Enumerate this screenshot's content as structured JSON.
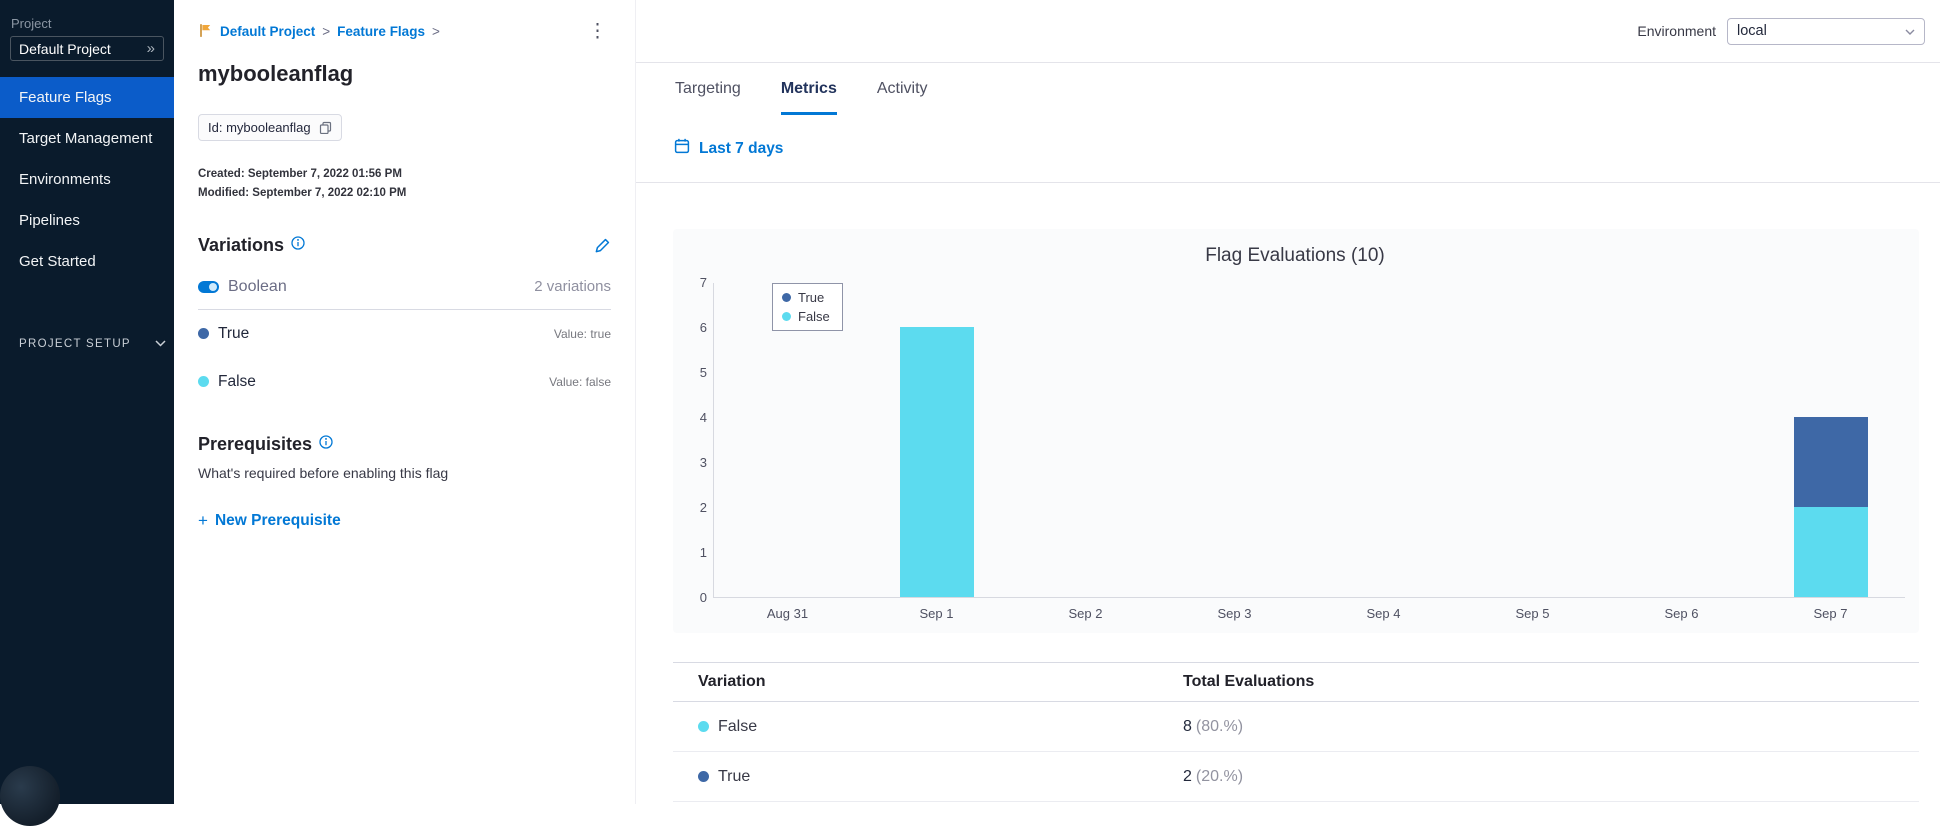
{
  "icons": {
    "kebab": "⋮",
    "expand": "»",
    "plus": "+",
    "crumb_separator": ">"
  },
  "sidebar": {
    "project_label": "Project",
    "project_selector": "Default Project",
    "items": [
      {
        "label": "Feature Flags",
        "active": true
      },
      {
        "label": "Target Management",
        "active": false
      },
      {
        "label": "Environments",
        "active": false
      },
      {
        "label": "Pipelines",
        "active": false
      },
      {
        "label": "Get Started",
        "active": false
      }
    ],
    "project_setup_label": "PROJECT SETUP"
  },
  "detail": {
    "breadcrumb": {
      "project": "Default Project",
      "section": "Feature Flags"
    },
    "title": "mybooleanflag",
    "id_badge": "Id: mybooleanflag",
    "created": "Created: September 7, 2022 01:56 PM",
    "modified": "Modified: September 7, 2022 02:10 PM",
    "variations": {
      "heading": "Variations",
      "type_label": "Boolean",
      "count_label": "2 variations",
      "items": [
        {
          "name": "True",
          "value_label": "Value: true",
          "color": "#3e68a6"
        },
        {
          "name": "False",
          "value_label": "Value: false",
          "color": "#5cdbef"
        }
      ]
    },
    "prerequisites": {
      "heading": "Prerequisites",
      "description": "What's required before enabling this flag",
      "new_button_label": "New Prerequisite"
    }
  },
  "main": {
    "environment_label": "Environment",
    "environment_value": "local",
    "tabs": [
      {
        "label": "Targeting",
        "active": false
      },
      {
        "label": "Metrics",
        "active": true
      },
      {
        "label": "Activity",
        "active": false
      }
    ],
    "date_range_label": "Last 7 days",
    "table": {
      "headers": [
        "Variation",
        "Total Evaluations"
      ],
      "rows": [
        {
          "name": "False",
          "color": "#5cdbef",
          "count": "8",
          "percent": "(80.%)"
        },
        {
          "name": "True",
          "color": "#3e68a6",
          "count": "2",
          "percent": "(20.%)"
        }
      ]
    }
  },
  "chart_data": {
    "type": "bar",
    "stacked": true,
    "title": "Flag Evaluations (10)",
    "total_evaluations": 10,
    "categories": [
      "Aug 31",
      "Sep 1",
      "Sep 2",
      "Sep 3",
      "Sep 4",
      "Sep 5",
      "Sep 6",
      "Sep 7"
    ],
    "series": [
      {
        "name": "True",
        "color": "#3e68a6",
        "values": [
          0,
          0,
          0,
          0,
          0,
          0,
          0,
          2
        ]
      },
      {
        "name": "False",
        "color": "#5cdbef",
        "values": [
          0,
          6,
          0,
          0,
          0,
          0,
          0,
          2
        ]
      }
    ],
    "ylim": [
      0,
      7
    ],
    "yticks": [
      0,
      1,
      2,
      3,
      4,
      5,
      6,
      7
    ],
    "xlabel": "",
    "ylabel": "",
    "grid": false,
    "legend_position": "top-left"
  }
}
